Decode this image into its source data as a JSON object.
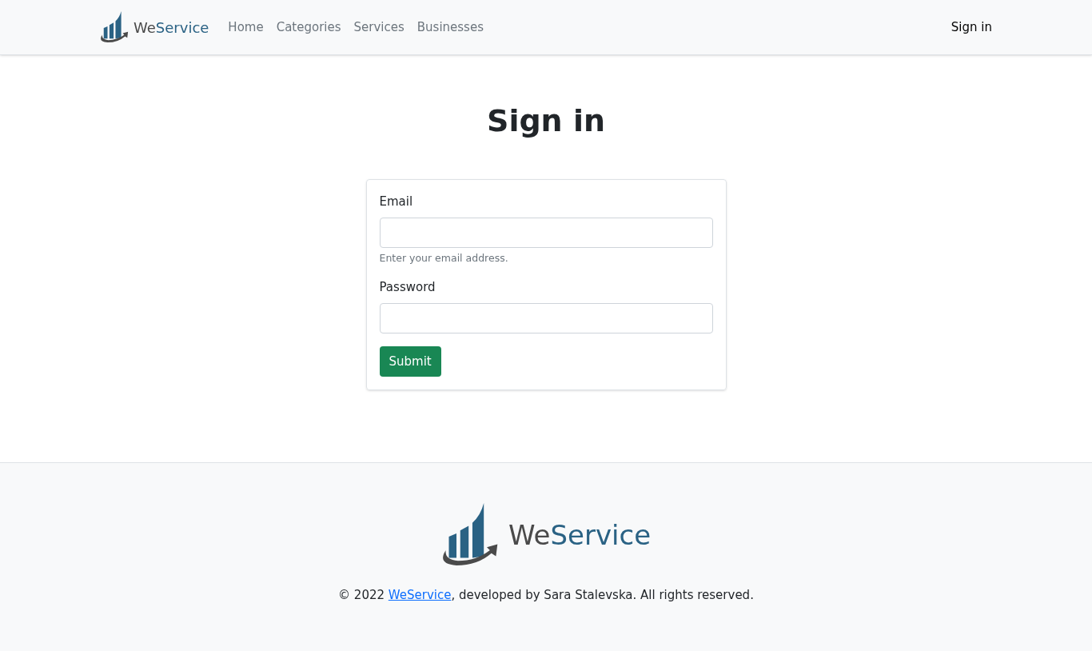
{
  "navbar": {
    "brand": {
      "part_1": "We",
      "part_2": "Service"
    },
    "links": [
      {
        "label": "Home"
      },
      {
        "label": "Categories"
      },
      {
        "label": "Services"
      },
      {
        "label": "Businesses"
      }
    ],
    "sign_in": "Sign in"
  },
  "heading": "Sign in",
  "form": {
    "fields": [
      {
        "label": "Email",
        "hint": "Enter your email address."
      },
      {
        "label": "Password"
      }
    ],
    "submit": "Submit"
  },
  "footer": {
    "brand": {
      "part_1": "We",
      "part_2": "Service"
    },
    "copyright": {
      "before": "© 2022 ",
      "link": "WeService",
      "after": ", developed by Sara Stalevska. All rights reserved."
    }
  }
}
